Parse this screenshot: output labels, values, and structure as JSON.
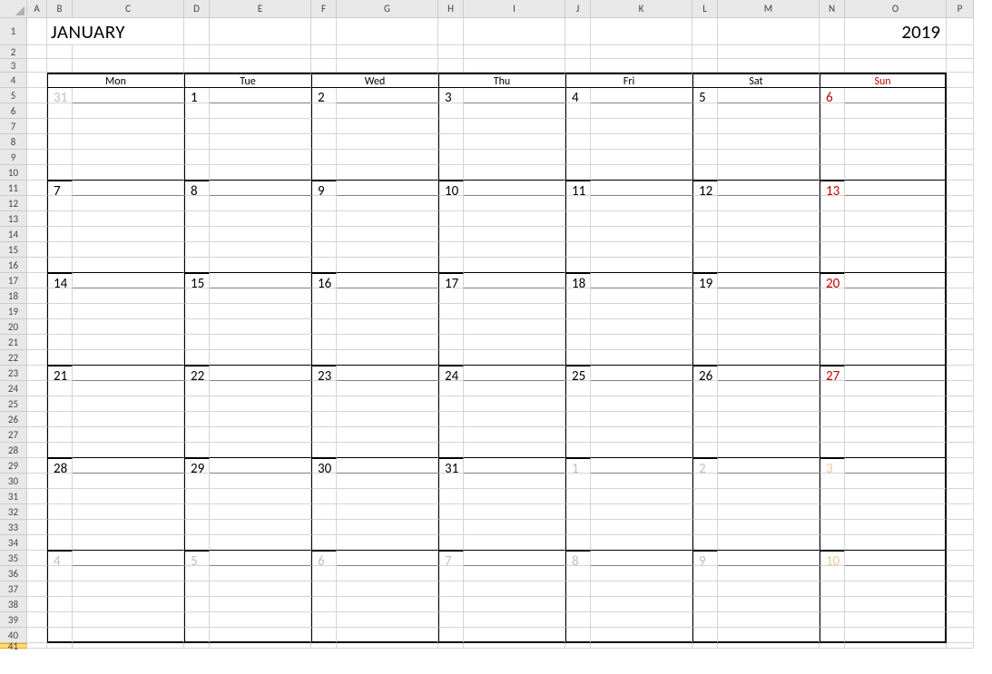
{
  "columns": [
    "A",
    "B",
    "C",
    "D",
    "E",
    "F",
    "G",
    "H",
    "I",
    "J",
    "K",
    "L",
    "M",
    "N",
    "O",
    "P"
  ],
  "row_count": 41,
  "month": "JANUARY",
  "year": "2019",
  "dow": [
    "Mon",
    "Tue",
    "Wed",
    "Thu",
    "Fri",
    "Sat",
    "Sun"
  ],
  "weeks": [
    [
      {
        "n": "31",
        "t": "out"
      },
      {
        "n": "1",
        "t": "cur"
      },
      {
        "n": "2",
        "t": "cur"
      },
      {
        "n": "3",
        "t": "cur"
      },
      {
        "n": "4",
        "t": "cur"
      },
      {
        "n": "5",
        "t": "cur"
      },
      {
        "n": "6",
        "t": "sun-cur"
      }
    ],
    [
      {
        "n": "7",
        "t": "cur"
      },
      {
        "n": "8",
        "t": "cur"
      },
      {
        "n": "9",
        "t": "cur"
      },
      {
        "n": "10",
        "t": "cur"
      },
      {
        "n": "11",
        "t": "cur"
      },
      {
        "n": "12",
        "t": "cur"
      },
      {
        "n": "13",
        "t": "sun-cur"
      }
    ],
    [
      {
        "n": "14",
        "t": "cur"
      },
      {
        "n": "15",
        "t": "cur"
      },
      {
        "n": "16",
        "t": "cur"
      },
      {
        "n": "17",
        "t": "cur"
      },
      {
        "n": "18",
        "t": "cur"
      },
      {
        "n": "19",
        "t": "cur"
      },
      {
        "n": "20",
        "t": "sun-cur"
      }
    ],
    [
      {
        "n": "21",
        "t": "cur"
      },
      {
        "n": "22",
        "t": "cur"
      },
      {
        "n": "23",
        "t": "cur"
      },
      {
        "n": "24",
        "t": "cur"
      },
      {
        "n": "25",
        "t": "cur"
      },
      {
        "n": "26",
        "t": "cur"
      },
      {
        "n": "27",
        "t": "sun-cur"
      }
    ],
    [
      {
        "n": "28",
        "t": "cur"
      },
      {
        "n": "29",
        "t": "cur"
      },
      {
        "n": "30",
        "t": "cur"
      },
      {
        "n": "31",
        "t": "cur"
      },
      {
        "n": "1",
        "t": "out"
      },
      {
        "n": "2",
        "t": "out"
      },
      {
        "n": "3",
        "t": "sun-out"
      }
    ],
    [
      {
        "n": "4",
        "t": "out"
      },
      {
        "n": "5",
        "t": "out"
      },
      {
        "n": "6",
        "t": "out"
      },
      {
        "n": "7",
        "t": "out"
      },
      {
        "n": "8",
        "t": "out"
      },
      {
        "n": "9",
        "t": "out"
      },
      {
        "n": "10",
        "t": "sun-out"
      }
    ]
  ]
}
